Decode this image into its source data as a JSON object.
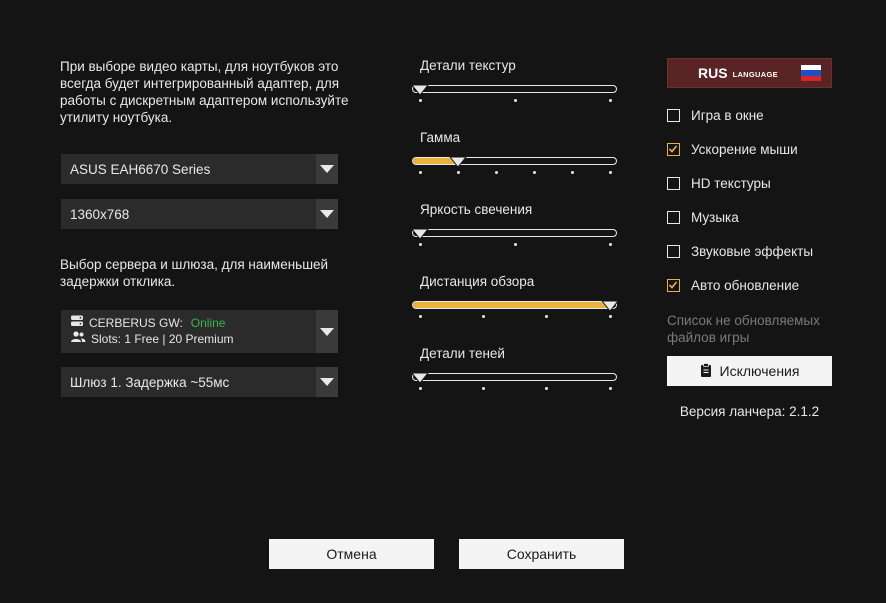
{
  "left": {
    "gpu_note": "При выборе видео карты, для ноутбуков это всегда будет интегрированный адаптер, для работы с дискретным адаптером используйте утилиту ноутбука.",
    "gpu_value": "ASUS EAH6670 Series",
    "resolution_value": "1360x768",
    "server_note": "Выбор сервера и шлюза, для наименьшей задержки отклика.",
    "server": {
      "name": "CERBERUS GW:",
      "status": "Online",
      "status_color": "#39b54a",
      "slots": "Slots: 1 Free | 20 Premium"
    },
    "gateway_value": "Шлюз 1. Задержка ~55мс"
  },
  "sliders": [
    {
      "label": "Детали текстур",
      "value_fraction": 0.0,
      "ticks": 3
    },
    {
      "label": "Гамма",
      "value_fraction": 0.2,
      "ticks": 6
    },
    {
      "label": "Яркость свечения",
      "value_fraction": 0.0,
      "ticks": 3
    },
    {
      "label": "Дистанция обзора",
      "value_fraction": 1.0,
      "ticks": 4
    },
    {
      "label": "Детали теней",
      "value_fraction": 0.0,
      "ticks": 4
    }
  ],
  "right": {
    "language_code": "RUS",
    "language_label": "LANGUAGE",
    "options": [
      {
        "label": "Игра в окне",
        "checked": false
      },
      {
        "label": "Ускорение мыши",
        "checked": true
      },
      {
        "label": "HD текстуры",
        "checked": false
      },
      {
        "label": "Музыка",
        "checked": false
      },
      {
        "label": "Звуковые эффекты",
        "checked": false
      },
      {
        "label": "Авто обновление",
        "checked": true
      }
    ],
    "exclusions_note": "Список не обновляемых файлов игры",
    "exclusions_button": "Исключения",
    "version": "Версия ланчера: 2.1.2"
  },
  "footer": {
    "cancel": "Отмена",
    "save": "Сохранить"
  },
  "colors": {
    "background": "#141414",
    "accent": "#e8b33c",
    "language_button": "#5a2424"
  },
  "icons": [
    "chevron-down-icon",
    "server-icon",
    "users-icon",
    "clipboard-icon",
    "russian-flag-icon",
    "checkmark-icon"
  ]
}
